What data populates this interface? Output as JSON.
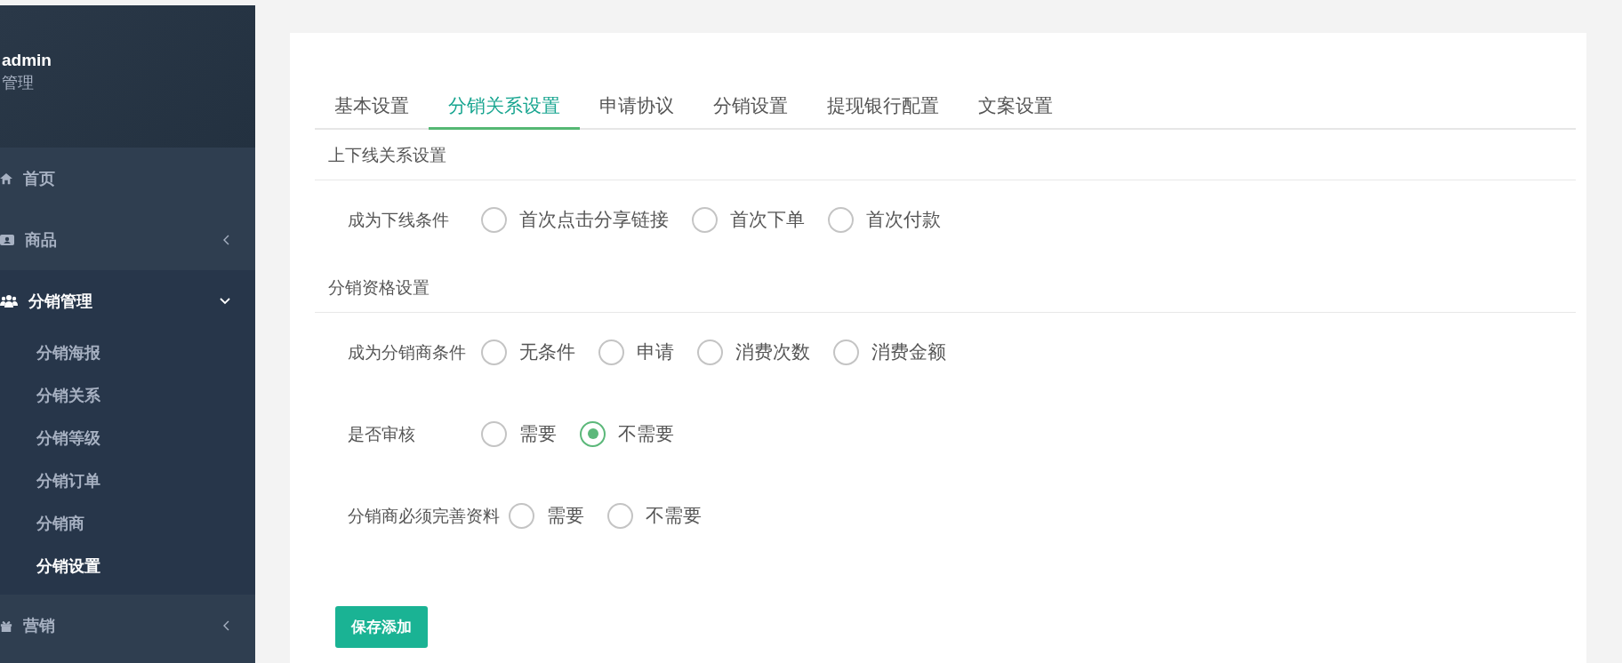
{
  "sidebar": {
    "user": {
      "name": "admin",
      "role": "管理"
    },
    "items": [
      {
        "label": "首页",
        "kind": "link",
        "expanded": false
      },
      {
        "label": "商品",
        "kind": "menu",
        "expanded": false
      },
      {
        "label": "分销管理",
        "kind": "menu",
        "expanded": true,
        "children": [
          {
            "label": "分销海报",
            "selected": false
          },
          {
            "label": "分销关系",
            "selected": false
          },
          {
            "label": "分销等级",
            "selected": false
          },
          {
            "label": "分销订单",
            "selected": false
          },
          {
            "label": "分销商",
            "selected": false
          },
          {
            "label": "分销设置",
            "selected": true
          }
        ]
      },
      {
        "label": "营销",
        "kind": "menu",
        "expanded": false
      }
    ]
  },
  "tabs": [
    {
      "label": "基本设置",
      "selected": false
    },
    {
      "label": "分销关系设置",
      "selected": true
    },
    {
      "label": "申请协议",
      "selected": false
    },
    {
      "label": "分销设置",
      "selected": false
    },
    {
      "label": "提现银行配置",
      "selected": false
    },
    {
      "label": "文案设置",
      "selected": false
    }
  ],
  "sections": [
    {
      "title": "上下线关系设置",
      "fields": [
        {
          "label": "成为下线条件",
          "options": [
            {
              "label": "首次点击分享链接",
              "selected": false
            },
            {
              "label": "首次下单",
              "selected": false
            },
            {
              "label": "首次付款",
              "selected": false
            }
          ]
        }
      ]
    },
    {
      "title": "分销资格设置",
      "fields": [
        {
          "label": "成为分销商条件",
          "options": [
            {
              "label": "无条件",
              "selected": false
            },
            {
              "label": "申请",
              "selected": false
            },
            {
              "label": "消费次数",
              "selected": false
            },
            {
              "label": "消费金额",
              "selected": false
            }
          ]
        },
        {
          "label": "是否审核",
          "options": [
            {
              "label": "需要",
              "selected": false
            },
            {
              "label": "不需要",
              "selected": true
            }
          ]
        },
        {
          "label": "分销商必须完善资料",
          "options": [
            {
              "label": "需要",
              "selected": false
            },
            {
              "label": "不需要",
              "selected": false
            }
          ]
        }
      ]
    }
  ],
  "save_button": "保存添加"
}
